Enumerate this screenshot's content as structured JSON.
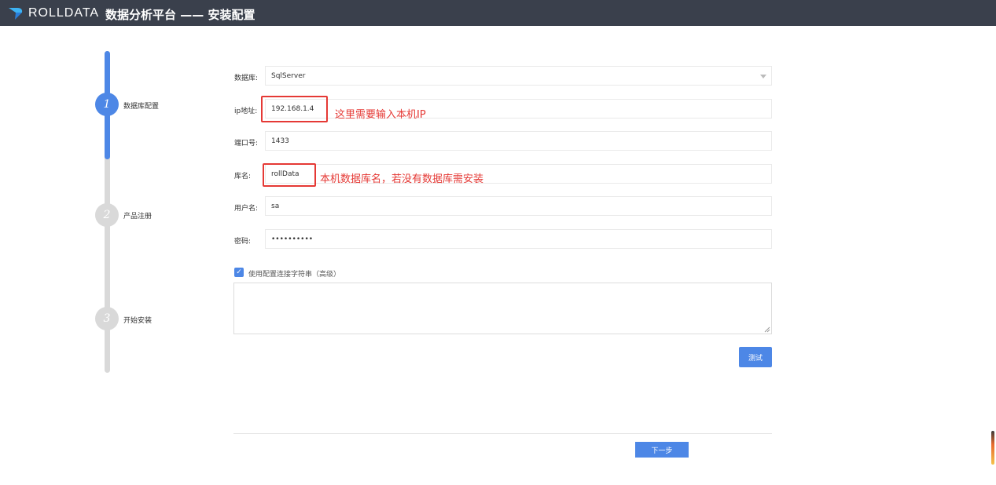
{
  "header": {
    "brand": "ROLLDATA",
    "title": "数据分析平台 —— 安装配置",
    "logo_icon": "rolldata-logo-icon",
    "bg_color": "#3a404c"
  },
  "steps": [
    {
      "number": "1",
      "label": "数据库配置",
      "state": "active"
    },
    {
      "number": "2",
      "label": "产品注册",
      "state": "inactive"
    },
    {
      "number": "3",
      "label": "开始安装",
      "state": "inactive"
    }
  ],
  "form": {
    "database": {
      "label": "数据库:",
      "value": "SqlServer"
    },
    "ip": {
      "label": "ip地址:",
      "value": "192.168.1.4"
    },
    "port": {
      "label": "端口号:",
      "value": "1433"
    },
    "dbname": {
      "label": "库名:",
      "value": "rollData"
    },
    "username": {
      "label": "用户名:",
      "value": "sa"
    },
    "password": {
      "label": "密码:",
      "value": "••••••••••"
    },
    "use_conn_string": {
      "label": "使用配置连接字符串（高级）",
      "checked": true
    },
    "conn_string": {
      "value": ""
    },
    "test_button": "测试",
    "next_button": "下一步"
  },
  "annotations": {
    "ip_note": "这里需要输入本机IP",
    "dbname_note": "本机数据库名，若没有数据库需安装"
  },
  "colors": {
    "accent": "#4d87e6",
    "annotation": "#e53935"
  }
}
